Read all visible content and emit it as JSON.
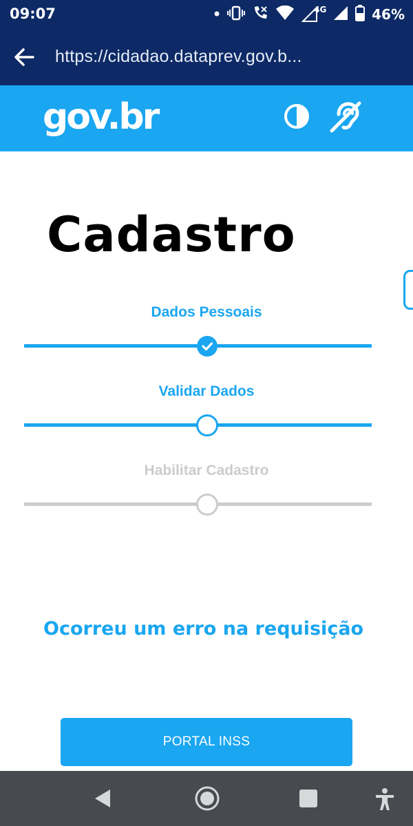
{
  "status_bar": {
    "time": "09:07",
    "network_label": "4G",
    "battery_percent": "46%"
  },
  "browser": {
    "url": "https://cidadao.dataprev.gov.b..."
  },
  "header": {
    "logo": "gov.br",
    "contrast_icon": "contrast-icon",
    "accessibility_icon": "hearing-accessibility-icon"
  },
  "page": {
    "title": "Cadastro",
    "steps": [
      {
        "label": "Dados Pessoais",
        "state": "completed",
        "color": "#1aa6f0"
      },
      {
        "label": "Validar Dados",
        "state": "current",
        "color": "#1aa6f0"
      },
      {
        "label": "Habilitar Cadastro",
        "state": "pending",
        "color": "#cccccc"
      }
    ],
    "error_message": "Ocorreu um erro na requisição",
    "portal_button": "PORTAL INSS"
  },
  "nav_bar": {
    "back_icon": "back-triangle-icon",
    "home_icon": "home-circle-icon",
    "recents_icon": "recents-square-icon",
    "accessibility_icon": "accessibility-person-icon"
  },
  "colors": {
    "brand_dark": "#0d2a66",
    "accent": "#1aa6f0",
    "disabled": "#cccccc",
    "nav_bar": "#474a4f"
  }
}
